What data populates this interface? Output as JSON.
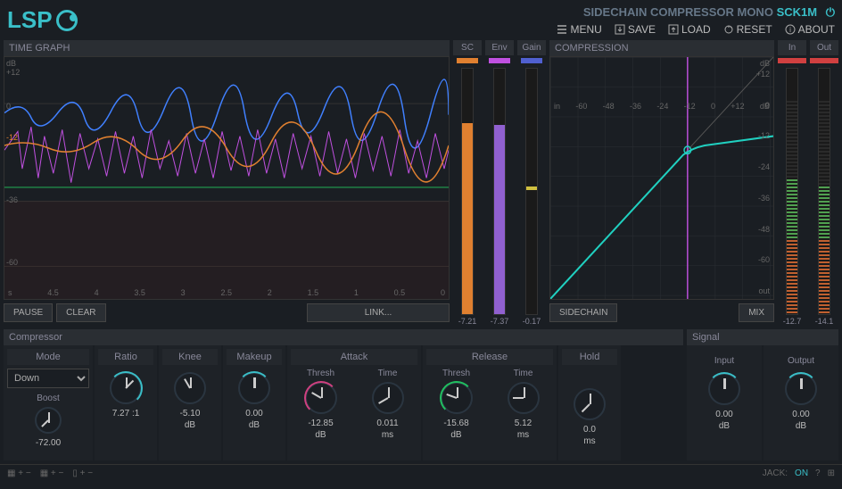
{
  "header": {
    "title": "SIDECHAIN COMPRESSOR MONO",
    "model": "SCK1M",
    "menu": {
      "menu": "MENU",
      "save": "SAVE",
      "load": "LOAD",
      "reset": "RESET",
      "about": "ABOUT"
    }
  },
  "timeGraph": {
    "title": "TIME GRAPH",
    "yUnit": "dB",
    "yMax": "+12",
    "yTicks": [
      "0",
      "-12",
      "-36",
      "-60"
    ],
    "xUnit": "s",
    "xTicks": [
      "4.5",
      "4",
      "3.5",
      "3",
      "2.5",
      "2",
      "1.5",
      "1",
      "0.5",
      "0"
    ],
    "pause": "PAUSE",
    "clear": "CLEAR",
    "link": "LINK..."
  },
  "meters": {
    "sc": {
      "label": "SC",
      "color": "#e08030",
      "val": "-7.21"
    },
    "env": {
      "label": "Env",
      "color": "#c050e0",
      "val": "-7.37"
    },
    "gain": {
      "label": "Gain",
      "color": "#5060d0",
      "val": "-0.17"
    }
  },
  "compression": {
    "title": "COMPRESSION",
    "unit": "dB",
    "xTicks": [
      "in",
      "-60",
      "-48",
      "-36",
      "-24",
      "-12",
      "0",
      "+12",
      "dB"
    ],
    "yTicks": [
      "+12",
      "0",
      "-12",
      "-24",
      "-36",
      "-48",
      "-60",
      "out"
    ],
    "sidechain": "SIDECHAIN",
    "mix": "MIX"
  },
  "io": {
    "in": {
      "label": "In",
      "val": "-12.7"
    },
    "out": {
      "label": "Out",
      "val": "-14.1"
    }
  },
  "compressor": {
    "title": "Compressor",
    "mode": {
      "label": "Mode",
      "value": "Down",
      "boost": "Boost",
      "boostVal": "-72.00"
    },
    "ratio": {
      "label": "Ratio",
      "val": "7.27 :1"
    },
    "knee": {
      "label": "Knee",
      "val": "-5.10",
      "unit": "dB"
    },
    "makeup": {
      "label": "Makeup",
      "val": "0.00",
      "unit": "dB"
    },
    "attack": {
      "label": "Attack",
      "thresh": "Thresh",
      "threshVal": "-12.85",
      "threshUnit": "dB",
      "time": "Time",
      "timeVal": "0.011",
      "timeUnit": "ms"
    },
    "release": {
      "label": "Release",
      "thresh": "Thresh",
      "threshVal": "-15.68",
      "threshUnit": "dB",
      "time": "Time",
      "timeVal": "5.12",
      "timeUnit": "ms"
    },
    "hold": {
      "label": "Hold",
      "val": "0.0",
      "unit": "ms"
    }
  },
  "signal": {
    "title": "Signal",
    "input": {
      "label": "Input",
      "val": "0.00",
      "unit": "dB"
    },
    "output": {
      "label": "Output",
      "val": "0.00",
      "unit": "dB"
    }
  },
  "footer": {
    "jack": "JACK:",
    "jackState": "ON"
  }
}
